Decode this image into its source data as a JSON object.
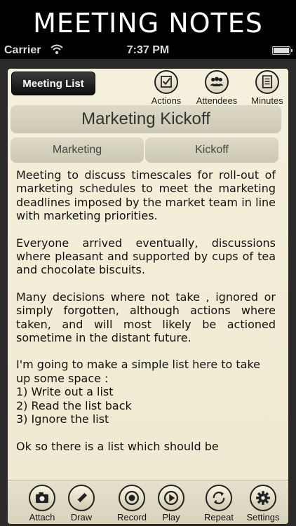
{
  "banner": {
    "title": "MEETING NOTES"
  },
  "status_bar": {
    "carrier": "Carrier",
    "time": "7:37 PM"
  },
  "toolbar": {
    "meeting_list_label": "Meeting List",
    "actions_label": "Actions",
    "attendees_label": "Attendees",
    "minutes_label": "Minutes"
  },
  "meeting": {
    "title": "Marketing Kickoff",
    "category": "Marketing",
    "type": "Kickoff"
  },
  "notes": {
    "p1": "Meeting to discuss timescales for roll-out of marketing schedules to meet the marketing deadlines imposed by the market team in line with marketing priorities.",
    "p2": "Everyone arrived eventually, discussions where pleasant and supported by cups of tea and chocolate biscuits.",
    "p3": "Many decisions where not take , ignored or simply forgotten, although actions where taken, and will most likely be actioned sometime in the distant future.",
    "p4": "I'm going to make a simple list here to take up some space :",
    "list": [
      "1) Write out a list",
      "2) Read the list back",
      "3) Ignore the list"
    ],
    "p5": "Ok so there is a list which should be"
  },
  "bottom_bar": {
    "attach_label": "Attach",
    "draw_label": "Draw",
    "record_label": "Record",
    "play_label": "Play",
    "repeat_label": "Repeat",
    "settings_label": "Settings"
  }
}
